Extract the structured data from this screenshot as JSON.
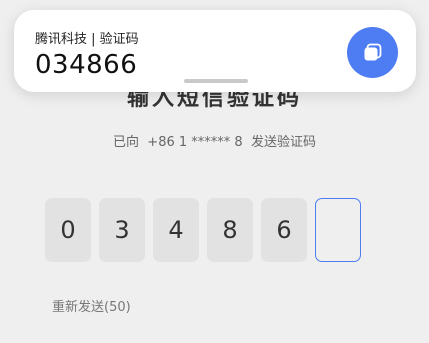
{
  "notification": {
    "title": "腾讯科技 | 验证码",
    "code": "034866",
    "copy_icon": "copy-icon",
    "accent_color": "#4e7df3"
  },
  "page": {
    "title": "输入短信验证码",
    "subtitle": "已向  +86 1 ****** 8  发送验证码",
    "code_digits": [
      "0",
      "3",
      "4",
      "8",
      "6",
      ""
    ],
    "resend_label": "重新发送(50)"
  }
}
